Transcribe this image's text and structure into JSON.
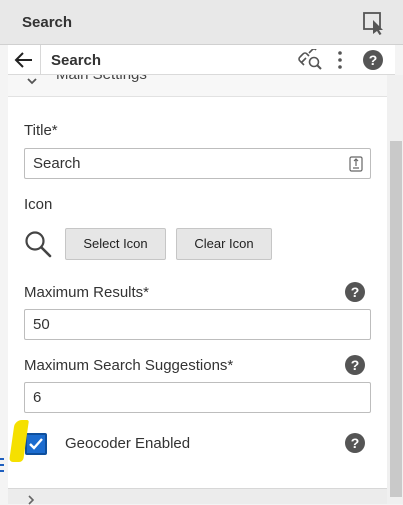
{
  "header": {
    "title": "Search",
    "pick_icon": "pointer-select-icon"
  },
  "subheader": {
    "title": "Search",
    "back_icon": "arrow-left-icon",
    "link_icon": "link-search-icon",
    "more_icon": "more-vertical-icon",
    "help_icon": "help-circle-icon"
  },
  "section": {
    "title": "Main Settings",
    "icon": "chevron-down-icon"
  },
  "form": {
    "title": {
      "label": "Title*",
      "value": "Search",
      "icon": "text-entry-icon"
    },
    "icon": {
      "label": "Icon",
      "preview_icon": "magnifier-icon",
      "select_label": "Select Icon",
      "clear_label": "Clear Icon"
    },
    "max_results": {
      "label": "Maximum Results*",
      "value": "50",
      "help_icon": "help-circle-icon"
    },
    "max_suggestions": {
      "label": "Maximum Search Suggestions*",
      "value": "6",
      "help_icon": "help-circle-icon"
    },
    "geocoder": {
      "label": "Geocoder Enabled",
      "checked": true,
      "help_icon": "help-circle-icon"
    }
  },
  "colors": {
    "accent": "#1c6ccf",
    "highlight": "#f5e000"
  }
}
